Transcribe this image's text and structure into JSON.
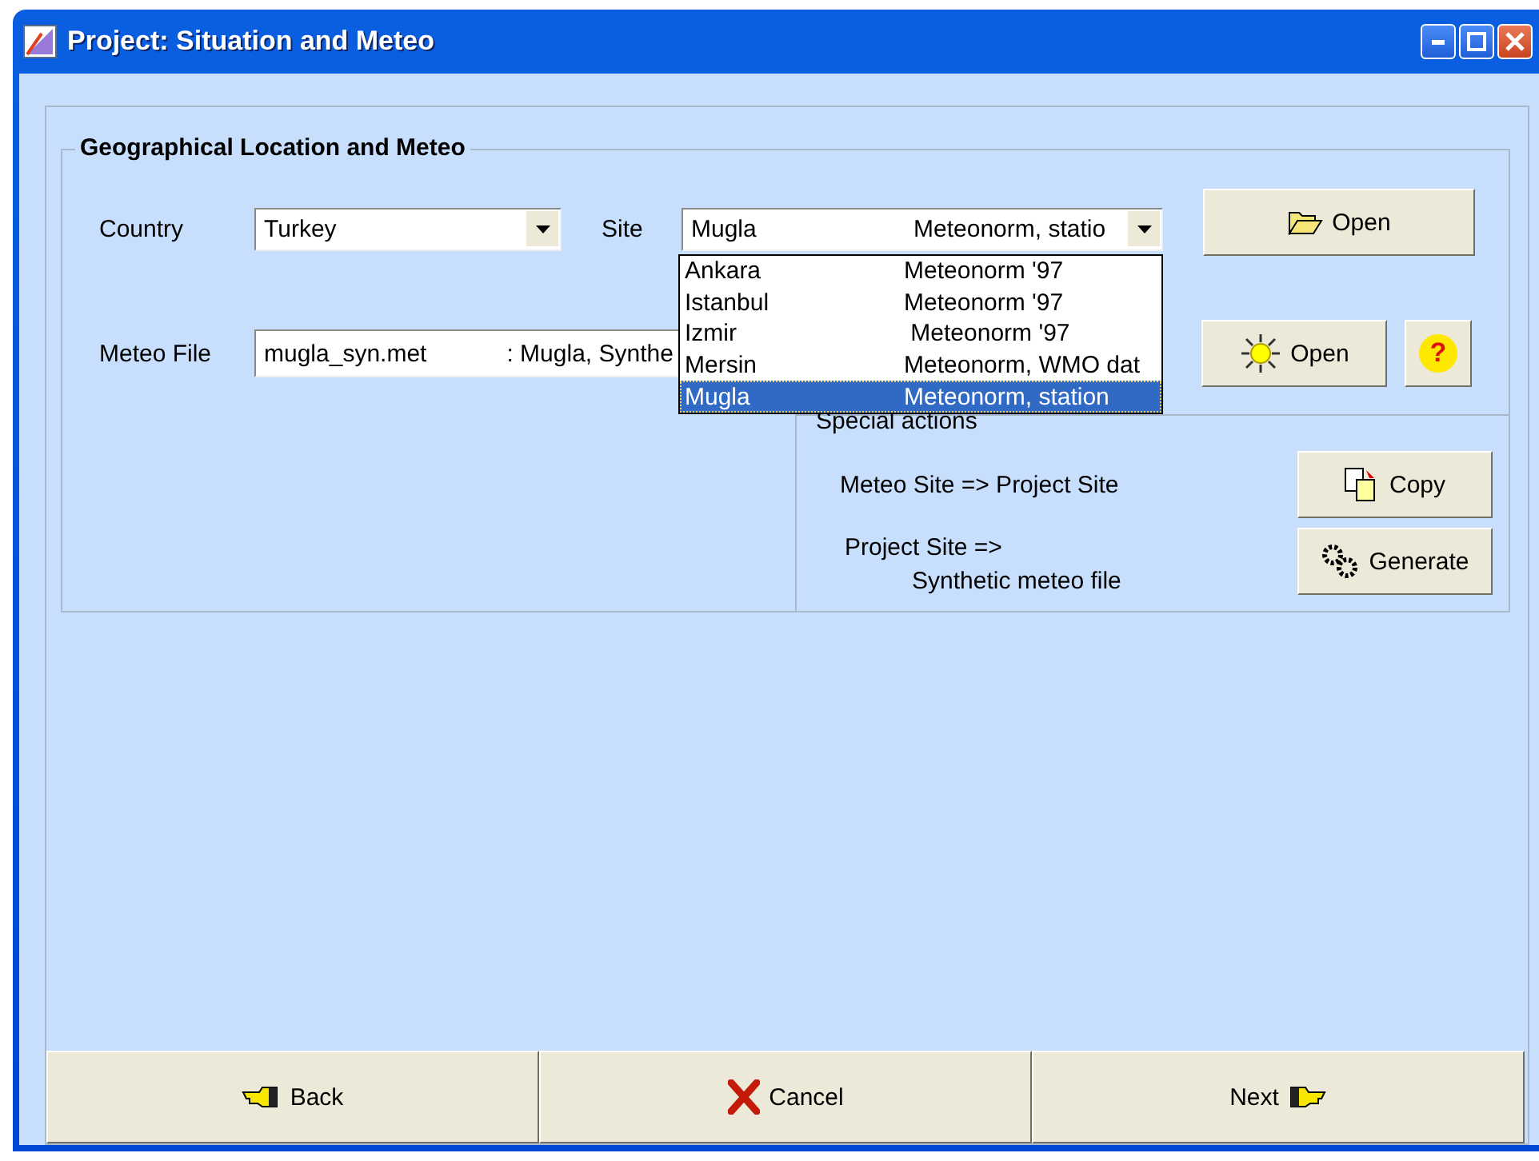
{
  "window": {
    "title": "Project: Situation and Meteo"
  },
  "group": {
    "title": "Geographical Location and Meteo"
  },
  "country": {
    "label": "Country",
    "value": "Turkey"
  },
  "site": {
    "label": "Site",
    "value": "Mugla",
    "source": "Meteonorm, statio",
    "options": [
      {
        "name": "Ankara",
        "source": "Meteonorm '97",
        "selected": false
      },
      {
        "name": "Istanbul",
        "source": "Meteonorm '97",
        "selected": false
      },
      {
        "name": "Izmir",
        "source": " Meteonorm '97",
        "selected": false
      },
      {
        "name": "Mersin",
        "source": "Meteonorm, WMO dat",
        "selected": false
      },
      {
        "name": "Mugla",
        "source": "Meteonorm, station",
        "selected": true
      }
    ]
  },
  "site_open_button": "Open",
  "meteo_file": {
    "label": "Meteo File",
    "value": "mugla_syn.met",
    "description": ": Mugla, Synthe"
  },
  "meteo_open_button": "Open",
  "help_button": "?",
  "special_actions": {
    "title": "Special actions",
    "copy_text": "Meteo Site => Project Site",
    "copy_button": "Copy",
    "generate_lines": [
      "Project Site =>",
      "Synthetic meteo file"
    ],
    "generate_button": "Generate"
  },
  "footer_buttons": [
    "Back",
    "Cancel",
    "Next"
  ]
}
